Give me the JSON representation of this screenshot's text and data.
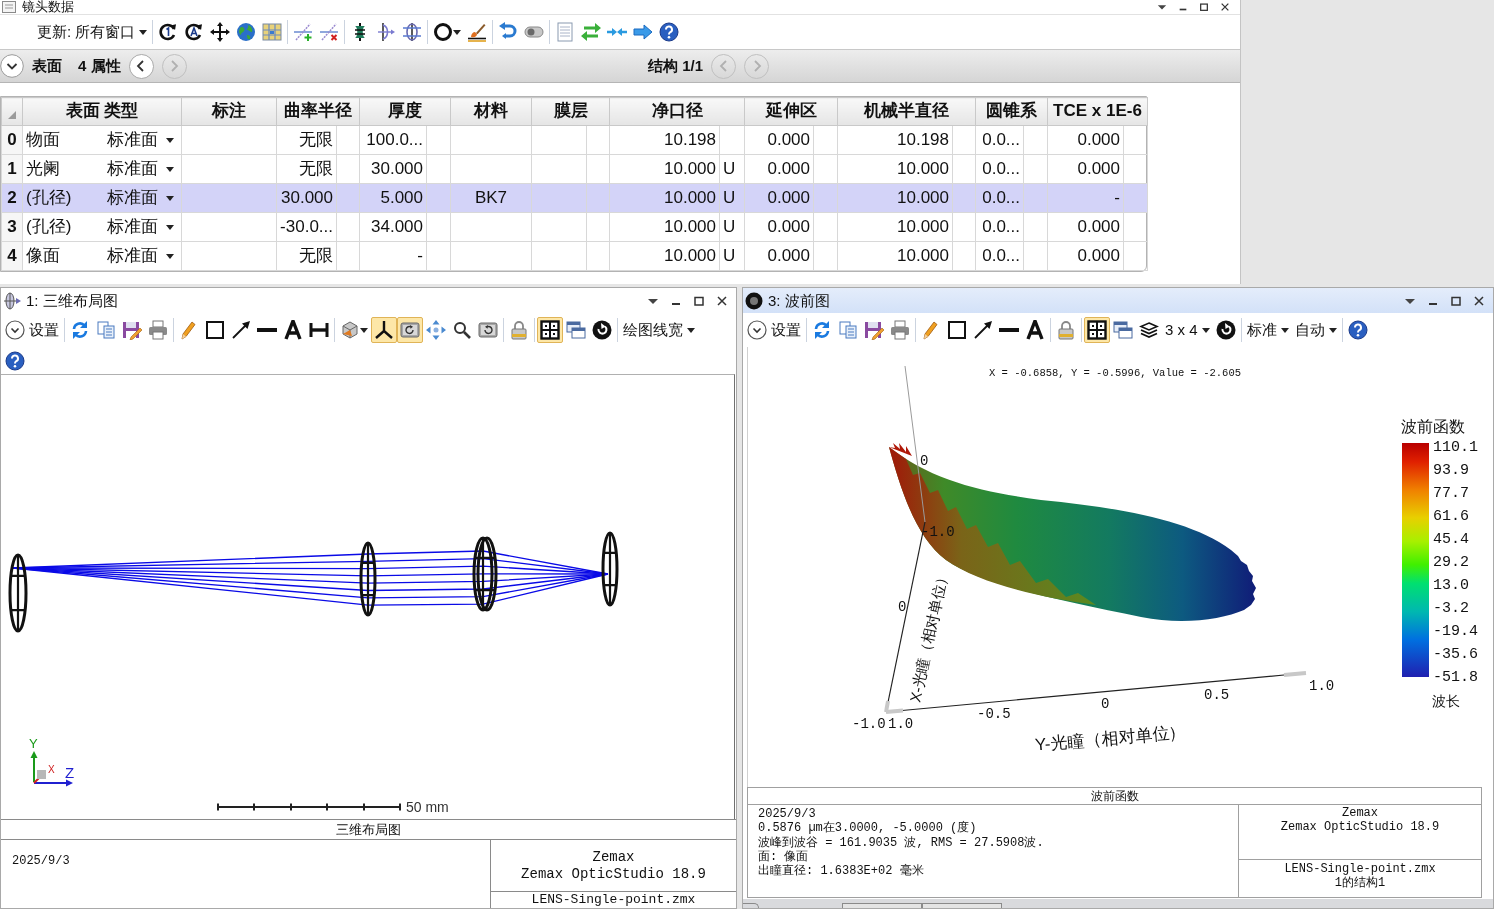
{
  "lens_data_window": {
    "title": "镜头数据",
    "toolbar": [
      [
        {
          "kind": "menu",
          "label": "更新: 所有窗口"
        }
      ],
      [
        {
          "kind": "rotate_1"
        },
        {
          "kind": "rotate_a"
        },
        {
          "kind": "move"
        },
        {
          "kind": "globe"
        },
        {
          "kind": "map"
        }
      ],
      [
        {
          "kind": "add_line"
        },
        {
          "kind": "delete_line"
        }
      ],
      [
        {
          "kind": "lens_green"
        },
        {
          "kind": "lens_arrow"
        },
        {
          "kind": "lens_double"
        }
      ],
      [
        {
          "kind": "ring"
        },
        {
          "kind": "brush"
        }
      ],
      [
        {
          "kind": "undo"
        },
        {
          "kind": "switch"
        }
      ],
      [
        {
          "kind": "page"
        },
        {
          "kind": "swap"
        },
        {
          "kind": "merge"
        },
        {
          "kind": "forward"
        },
        {
          "kind": "help"
        }
      ]
    ],
    "surface_bar": {
      "surface_label": "表面",
      "properties_label": "4 属性",
      "surface_nav": [
        {
          "kind": "prev",
          "disabled": false
        },
        {
          "kind": "next",
          "disabled": true
        }
      ],
      "config_label": "结构 1/1",
      "config_nav": [
        {
          "kind": "prev",
          "disabled": true
        },
        {
          "kind": "next",
          "disabled": true
        }
      ]
    },
    "table": {
      "columns": [
        "表面 类型",
        "标注",
        "曲率半径",
        "厚度",
        "材料",
        "膜层",
        "净口径",
        "延伸区",
        "机械半直径",
        "圆锥系",
        "TCE x 1E-6"
      ],
      "rows": [
        {
          "index": "0",
          "surface": "物面",
          "type": "标准面",
          "radius": "无限",
          "thickness": "100.0...",
          "clear_semi_dia": "10.198",
          "chip_zone": "0.000",
          "mech_semi_dia": "10.198",
          "conic": "0.0...",
          "tce": "0.000",
          "selected": false
        },
        {
          "index": "1",
          "surface": "光阑",
          "type": "标准面",
          "radius": "无限",
          "thickness": "30.000",
          "clear_semi_dia": "10.000",
          "clear_solve": "U",
          "chip_zone": "0.000",
          "mech_semi_dia": "10.000",
          "conic": "0.0...",
          "tce": "0.000",
          "selected": false
        },
        {
          "index": "2",
          "surface": "(孔径)",
          "type": "标准面",
          "radius": "30.000",
          "thickness": "5.000",
          "material": "BK7",
          "clear_semi_dia": "10.000",
          "clear_solve": "U",
          "chip_zone": "0.000",
          "mech_semi_dia": "10.000",
          "conic": "0.0...",
          "tce": "-",
          "selected": true
        },
        {
          "index": "3",
          "surface": "(孔径)",
          "type": "标准面",
          "radius": "-30.0...",
          "thickness": "34.000",
          "clear_semi_dia": "10.000",
          "clear_solve": "U",
          "chip_zone": "0.000",
          "mech_semi_dia": "10.000",
          "conic": "0.0...",
          "tce": "0.000",
          "selected": false
        },
        {
          "index": "4",
          "surface": "像面",
          "type": "标准面",
          "radius": "无限",
          "thickness": "-",
          "clear_semi_dia": "10.000",
          "clear_solve": "U",
          "chip_zone": "0.000",
          "mech_semi_dia": "10.000",
          "conic": "0.0...",
          "tce": "0.000",
          "selected": false
        }
      ]
    }
  },
  "layout_window": {
    "title": "1: 三维布局图",
    "active": false,
    "toolbar": [
      [
        {
          "kind": "settings",
          "label": "设置"
        }
      ],
      [
        {
          "kind": "refresh"
        },
        {
          "kind": "copy"
        },
        {
          "kind": "save"
        },
        {
          "kind": "print"
        }
      ],
      [
        {
          "kind": "pencil"
        },
        {
          "kind": "rectangle"
        },
        {
          "kind": "arrow"
        },
        {
          "kind": "line"
        },
        {
          "kind": "text"
        },
        {
          "kind": "dimension"
        }
      ],
      [
        {
          "kind": "view"
        },
        {
          "kind": "axes",
          "pressed": true
        },
        {
          "kind": "rotate",
          "pressed": true
        },
        {
          "kind": "pan",
          "pressed": false
        },
        {
          "kind": "zoom",
          "pressed": false
        },
        {
          "kind": "reset"
        }
      ],
      [
        {
          "kind": "lock"
        }
      ],
      [
        {
          "kind": "grid",
          "pressed": true
        },
        {
          "kind": "windows"
        },
        {
          "kind": "power"
        }
      ],
      [
        {
          "kind": "menu",
          "label": "绘图线宽"
        }
      ]
    ],
    "toolbar_overflow": [
      {
        "kind": "help"
      }
    ],
    "plot": {
      "axis_labels": {
        "y": "Y",
        "x": "X",
        "z": "Z"
      },
      "scale_label": "50 mm"
    },
    "caption": "三维布局图",
    "footer": {
      "date": "2025/9/3",
      "vendor": "Zemax",
      "product": "Zemax OpticStudio 18.9",
      "file": "LENS-Single-point.zmx"
    }
  },
  "wavefront_window": {
    "title": "3: 波前图",
    "active": true,
    "toolbar": [
      [
        {
          "kind": "settings",
          "label": "设置"
        }
      ],
      [
        {
          "kind": "refresh"
        },
        {
          "kind": "copy"
        },
        {
          "kind": "save"
        },
        {
          "kind": "print"
        }
      ],
      [
        {
          "kind": "pencil"
        },
        {
          "kind": "rectangle"
        },
        {
          "kind": "arrow"
        },
        {
          "kind": "line"
        },
        {
          "kind": "text"
        }
      ],
      [
        {
          "kind": "lock"
        }
      ],
      [
        {
          "kind": "grid",
          "pressed": true
        },
        {
          "kind": "windows"
        },
        {
          "kind": "layers"
        },
        {
          "kind": "menu",
          "label": "3 x 4"
        },
        {
          "kind": "power"
        }
      ],
      [
        {
          "kind": "menu",
          "label": "标准"
        },
        {
          "kind": "menu",
          "label": "自动"
        }
      ],
      [
        {
          "kind": "help"
        }
      ]
    ],
    "plot": {
      "readout": "X = -0.6858, Y = -0.5996, Value = -2.605",
      "vertical_ticks": [
        "0"
      ],
      "x_axis": {
        "title": "X-光瞳（相对单位）",
        "ticks": [
          "-1.0",
          "0",
          "1.0"
        ]
      },
      "y_axis": {
        "title": "Y-光瞳（相对单位）",
        "ticks": [
          "-1.0",
          "-0.5",
          "0",
          "0.5",
          "1.0"
        ]
      },
      "color_scale": {
        "title": "波前函数",
        "labels": [
          "110.1",
          "93.9",
          "77.7",
          "61.6",
          "45.4",
          "29.2",
          "13.0",
          "-3.2",
          "-19.4",
          "-35.6",
          "-51.8"
        ],
        "unit": "波长"
      }
    },
    "footer": {
      "caption": "波前函数",
      "lines": [
        "2025/9/3",
        "0.5876 µm在3.0000, -5.0000 (度)",
        "波峰到波谷 = 161.9035 波, RMS = 27.5908波.",
        "面: 像面",
        "出瞳直径: 1.6383E+02 毫米"
      ],
      "vendor": "Zemax",
      "product": "Zemax OpticStudio 18.9",
      "file": "LENS-Single-point.zmx",
      "config": "1的结构1"
    }
  }
}
